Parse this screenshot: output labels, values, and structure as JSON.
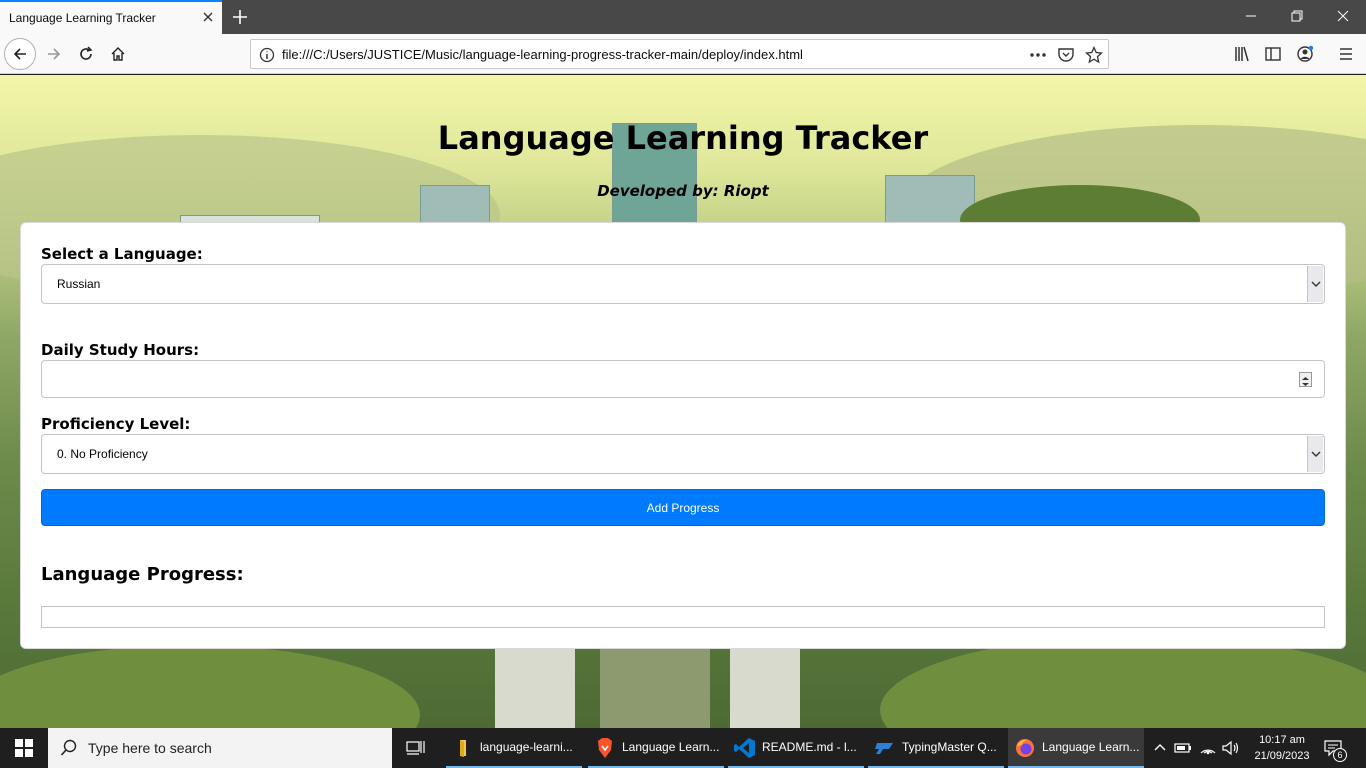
{
  "browser": {
    "tab_title": "Language Learning Tracker",
    "url": "file:///C:/Users/JUSTICE/Music/language-learning-progress-tracker-main/deploy/index.html"
  },
  "page": {
    "title": "Language Learning Tracker",
    "subtitle": "Developed by: Riopt",
    "language_label": "Select a Language:",
    "language_value": "Russian",
    "hours_label": "Daily Study Hours:",
    "hours_value": "",
    "proficiency_label": "Proficiency Level:",
    "proficiency_value": "0. No Proficiency",
    "add_button": "Add Progress",
    "progress_heading": "Language Progress:"
  },
  "taskbar": {
    "search_placeholder": "Type here to search",
    "apps": [
      {
        "label": "language-learni...",
        "icon": "folder-icon"
      },
      {
        "label": "Language Learn...",
        "icon": "brave-icon"
      },
      {
        "label": "README.md - l...",
        "icon": "vscode-icon"
      },
      {
        "label": "TypingMaster Q...",
        "icon": "typingmaster-icon"
      },
      {
        "label": "Language Learn...",
        "icon": "firefox-icon"
      }
    ],
    "time": "10:17 am",
    "date": "21/09/2023",
    "notification_count": "6"
  },
  "colors": {
    "accent": "#007bff",
    "tab_highlight": "#0a84ff"
  }
}
